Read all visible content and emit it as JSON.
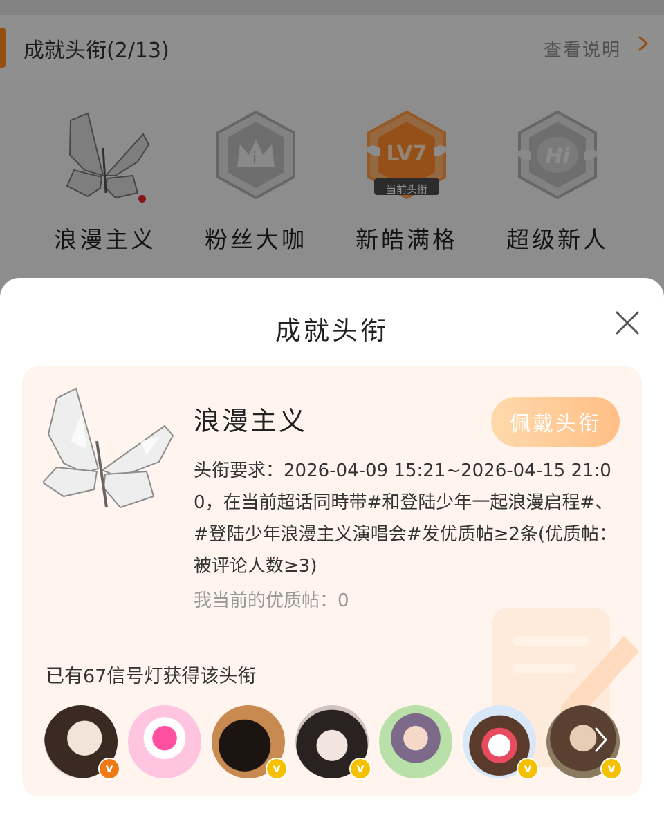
{
  "section": {
    "title": "成就头衔(2/13)",
    "link": "查看说明",
    "link_icon": "chevron-right-icon",
    "accent": "#ff8a1c"
  },
  "badges": [
    {
      "name": "浪漫主义",
      "icon": "butterfly-badge-icon",
      "has_new_dot": true
    },
    {
      "name": "粉丝大咖",
      "icon": "crown-hexagon-badge-icon"
    },
    {
      "name": "新皓满格",
      "icon": "lv7-hexagon-badge-icon",
      "tag": "当前头衔"
    },
    {
      "name": "超级新人",
      "icon": "hi-hexagon-badge-icon"
    }
  ],
  "sheet": {
    "title": "成就头衔",
    "close_icon": "close-icon"
  },
  "detail": {
    "name": "浪漫主义",
    "wear_button": "佩戴头衔",
    "requirement": "头衔要求：2026-04-09 15:21~2026-04-15 21:00，在当前超话同時带#和登陆少年一起浪漫启程#、#登陆少年浪漫主义演唱会#发优质帖≥2条(优质帖：被评论人数≥3)",
    "current": "我当前的优质帖：0",
    "owned_count": "已有67信号灯获得该头衔",
    "more_icon": "chevron-right-icon"
  },
  "avatars": [
    {
      "name": "avatar-1",
      "badge_color": "#f07a16"
    },
    {
      "name": "avatar-2",
      "badge_color": null
    },
    {
      "name": "avatar-3",
      "badge_color": "#f5c000"
    },
    {
      "name": "avatar-4",
      "badge_color": "#f5c000"
    },
    {
      "name": "avatar-5",
      "badge_color": null
    },
    {
      "name": "avatar-6",
      "badge_color": "#f5c000"
    },
    {
      "name": "avatar-7",
      "badge_color": "#f5c000"
    }
  ]
}
